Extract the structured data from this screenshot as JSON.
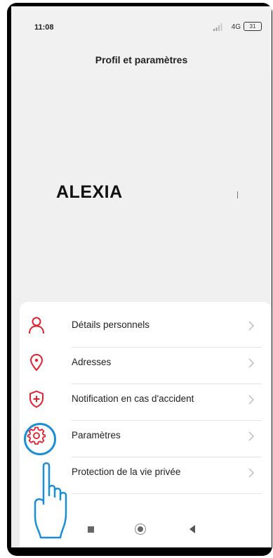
{
  "status_bar": {
    "time": "11:08",
    "network": "4G",
    "battery": "31"
  },
  "header": {
    "title": "Profil et paramètres"
  },
  "profile": {
    "name": "ALEXIA"
  },
  "menu": {
    "items": [
      {
        "label": "Détails personnels",
        "icon": "person-icon"
      },
      {
        "label": "Adresses",
        "icon": "location-pin-icon"
      },
      {
        "label": "Notification en cas d'accident",
        "icon": "shield-plus-icon"
      },
      {
        "label": "Paramètres",
        "icon": "gear-icon"
      },
      {
        "label": "Protection de la vie privée",
        "icon": "none"
      }
    ]
  },
  "navigation": {
    "buttons": [
      "recent-apps-button",
      "home-button",
      "back-button"
    ]
  },
  "colors": {
    "accent": "#e4202f",
    "highlight": "#1b8fd6",
    "background": "#efefef",
    "card": "#ffffff"
  }
}
